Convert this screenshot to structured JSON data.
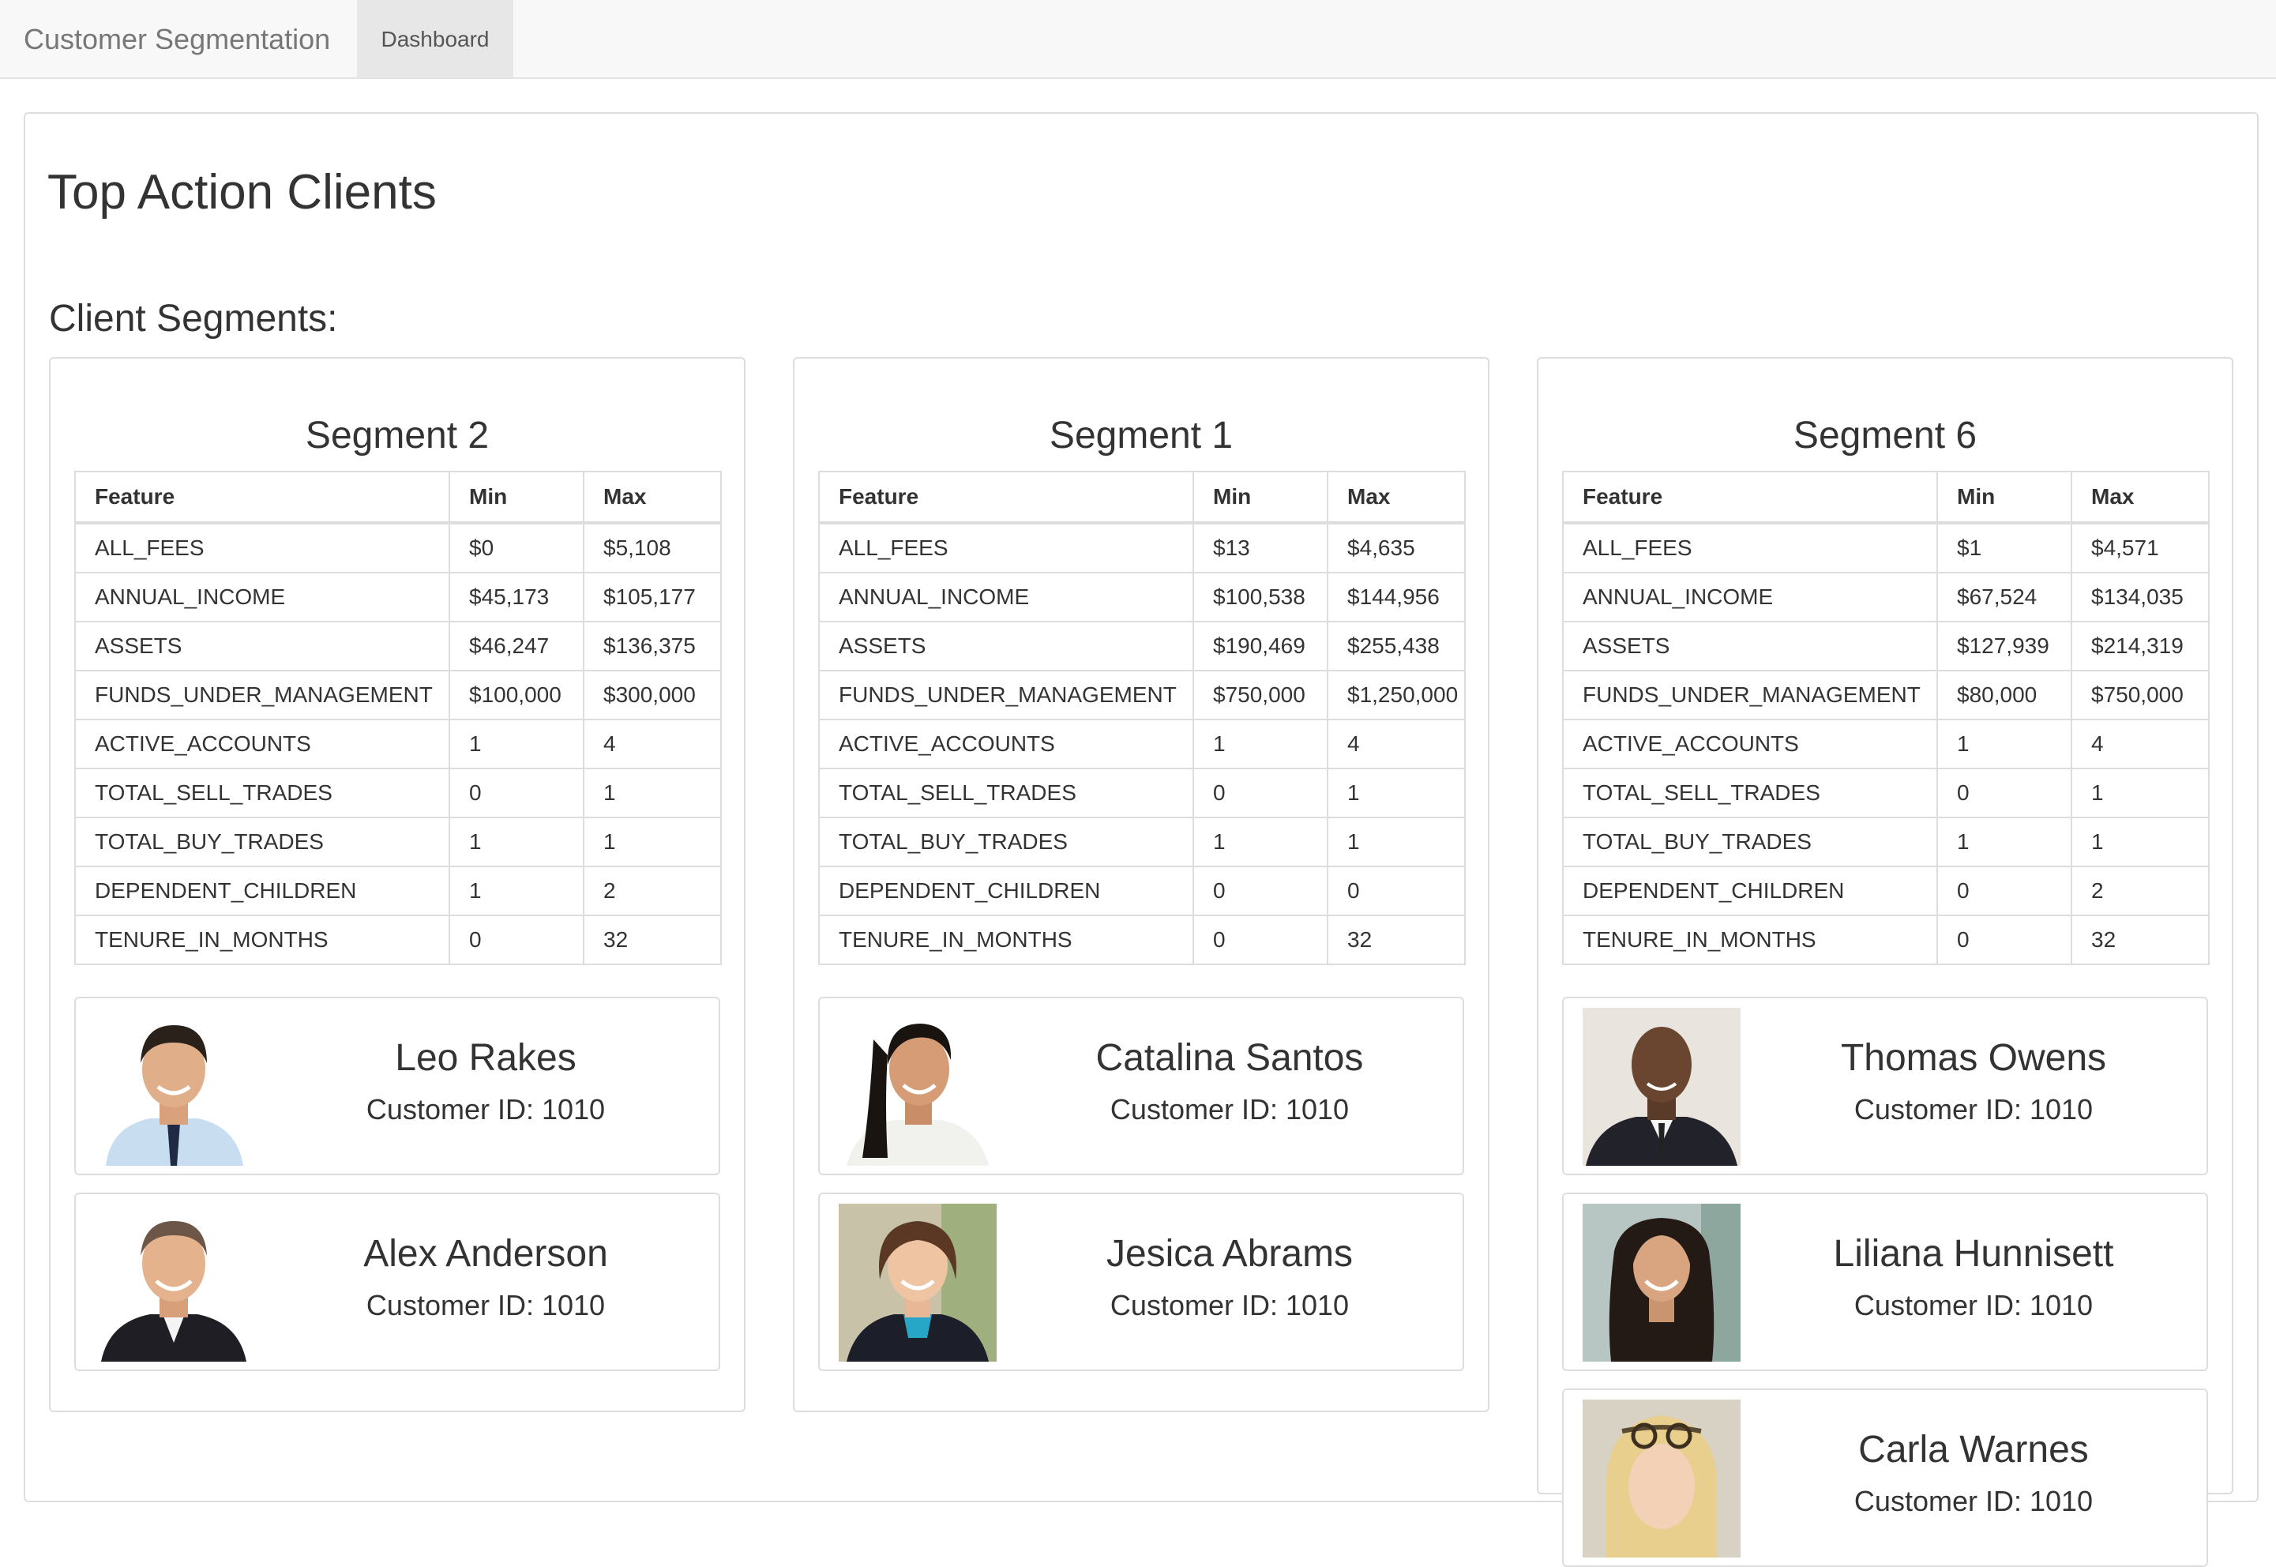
{
  "navbar": {
    "brand": "Customer Segmentation",
    "tabs": [
      {
        "label": "Dashboard"
      }
    ]
  },
  "page": {
    "title": "Top Action Clients",
    "section_title": "Client Segments:"
  },
  "table_headers": {
    "feature": "Feature",
    "min": "Min",
    "max": "Max"
  },
  "segments": [
    {
      "title": "Segment 2",
      "rows": [
        {
          "feature": "ALL_FEES",
          "min": "$0",
          "max": "$5,108"
        },
        {
          "feature": "ANNUAL_INCOME",
          "min": "$45,173",
          "max": "$105,177"
        },
        {
          "feature": "ASSETS",
          "min": "$46,247",
          "max": "$136,375"
        },
        {
          "feature": "FUNDS_UNDER_MANAGEMENT",
          "min": "$100,000",
          "max": "$300,000"
        },
        {
          "feature": "ACTIVE_ACCOUNTS",
          "min": "1",
          "max": "4"
        },
        {
          "feature": "TOTAL_SELL_TRADES",
          "min": "0",
          "max": "1"
        },
        {
          "feature": "TOTAL_BUY_TRADES",
          "min": "1",
          "max": "1"
        },
        {
          "feature": "DEPENDENT_CHILDREN",
          "min": "1",
          "max": "2"
        },
        {
          "feature": "TENURE_IN_MONTHS",
          "min": "0",
          "max": "32"
        }
      ],
      "customers": [
        {
          "name": "Leo Rakes",
          "customer_id": "Customer ID: 1010",
          "photo": "man-light-blue-shirt-photo"
        },
        {
          "name": "Alex Anderson",
          "customer_id": "Customer ID: 1010",
          "photo": "man-dark-suit-photo"
        }
      ]
    },
    {
      "title": "Segment 1",
      "rows": [
        {
          "feature": "ALL_FEES",
          "min": "$13",
          "max": "$4,635"
        },
        {
          "feature": "ANNUAL_INCOME",
          "min": "$100,538",
          "max": "$144,956"
        },
        {
          "feature": "ASSETS",
          "min": "$190,469",
          "max": "$255,438"
        },
        {
          "feature": "FUNDS_UNDER_MANAGEMENT",
          "min": "$750,000",
          "max": "$1,250,000"
        },
        {
          "feature": "ACTIVE_ACCOUNTS",
          "min": "1",
          "max": "4"
        },
        {
          "feature": "TOTAL_SELL_TRADES",
          "min": "0",
          "max": "1"
        },
        {
          "feature": "TOTAL_BUY_TRADES",
          "min": "1",
          "max": "1"
        },
        {
          "feature": "DEPENDENT_CHILDREN",
          "min": "0",
          "max": "0"
        },
        {
          "feature": "TENURE_IN_MONTHS",
          "min": "0",
          "max": "32"
        }
      ],
      "customers": [
        {
          "name": "Catalina Santos",
          "customer_id": "Customer ID: 1010",
          "photo": "woman-white-blazer-photo"
        },
        {
          "name": "Jesica Abrams",
          "customer_id": "Customer ID: 1010",
          "photo": "woman-curly-hair-photo"
        }
      ]
    },
    {
      "title": "Segment 6",
      "rows": [
        {
          "feature": "ALL_FEES",
          "min": "$1",
          "max": "$4,571"
        },
        {
          "feature": "ANNUAL_INCOME",
          "min": "$67,524",
          "max": "$134,035"
        },
        {
          "feature": "ASSETS",
          "min": "$127,939",
          "max": "$214,319"
        },
        {
          "feature": "FUNDS_UNDER_MANAGEMENT",
          "min": "$80,000",
          "max": "$750,000"
        },
        {
          "feature": "ACTIVE_ACCOUNTS",
          "min": "1",
          "max": "4"
        },
        {
          "feature": "TOTAL_SELL_TRADES",
          "min": "0",
          "max": "1"
        },
        {
          "feature": "TOTAL_BUY_TRADES",
          "min": "1",
          "max": "1"
        },
        {
          "feature": "DEPENDENT_CHILDREN",
          "min": "0",
          "max": "2"
        },
        {
          "feature": "TENURE_IN_MONTHS",
          "min": "0",
          "max": "32"
        }
      ],
      "customers": [
        {
          "name": "Thomas Owens",
          "customer_id": "Customer ID: 1010",
          "photo": "man-bald-dark-suit-photo"
        },
        {
          "name": "Liliana Hunnisett",
          "customer_id": "Customer ID: 1010",
          "photo": "woman-long-dark-hair-photo"
        },
        {
          "name": "Carla Warnes",
          "customer_id": "Customer ID: 1010",
          "photo": "woman-blonde-glasses-photo"
        }
      ]
    }
  ]
}
